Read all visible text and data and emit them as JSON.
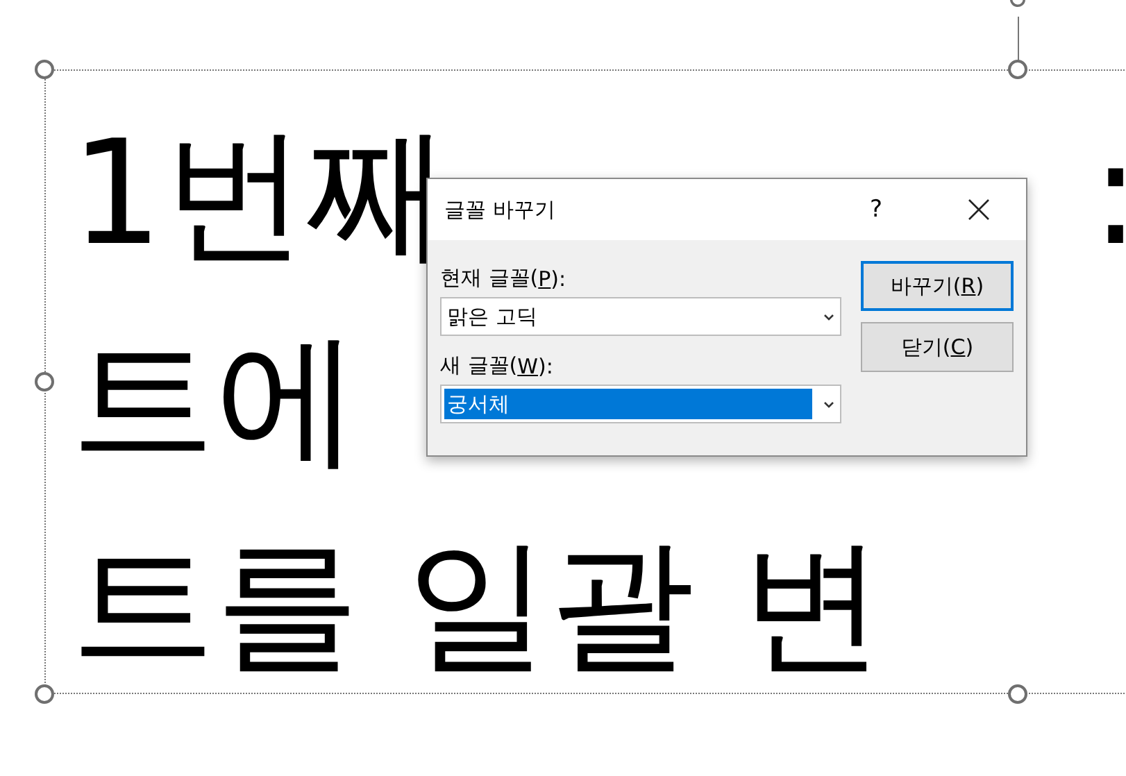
{
  "slide": {
    "lines": [
      {
        "left": "1번째",
        "right": ":"
      },
      {
        "left": "트에"
      },
      {
        "left": "트를 일괄 변"
      }
    ]
  },
  "dialog": {
    "title": "글꼴 바꾸기",
    "help": "?",
    "fields": [
      {
        "label_before": "현재 글꼴(",
        "access_key": "P",
        "label_after": "):",
        "value": "맑은 고딕",
        "selected": false
      },
      {
        "label_before": "새 글꼴(",
        "access_key": "W",
        "label_after": "):",
        "value": "궁서체",
        "selected": true
      }
    ],
    "buttons": [
      {
        "label_before": "바꾸기(",
        "access_key": "R",
        "label_after": ")",
        "default": true
      },
      {
        "label_before": "닫기(",
        "access_key": "C",
        "label_after": ")",
        "default": false
      }
    ]
  }
}
